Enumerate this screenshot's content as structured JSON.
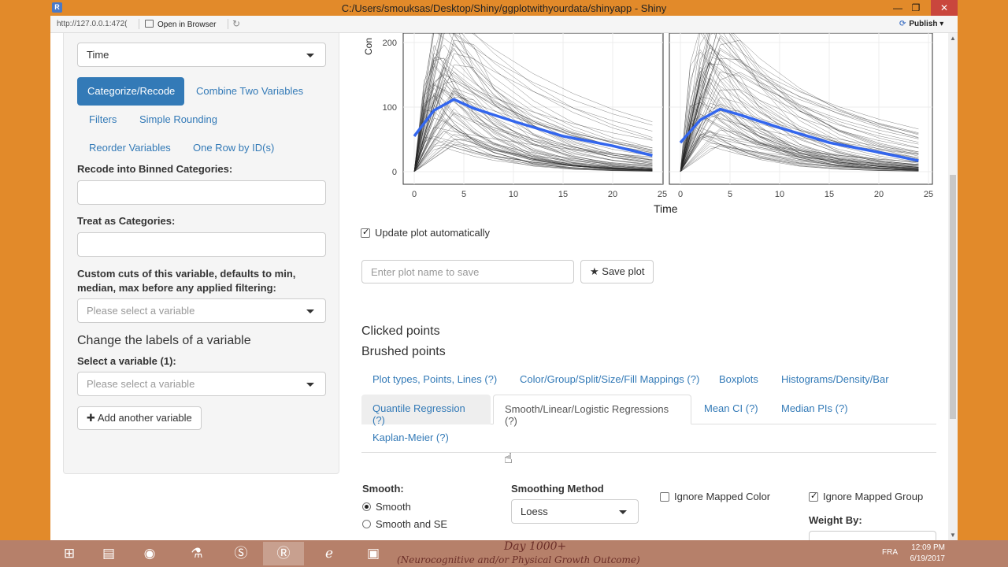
{
  "window": {
    "title": "C:/Users/smouksas/Desktop/Shiny/ggplotwithyourdata/shinyapp - Shiny",
    "minimize": "—",
    "maximize": "❐",
    "close": "✕"
  },
  "toolbar": {
    "url": "http://127.0.0.1:472(",
    "open_in_browser": "Open in Browser",
    "refresh": "↻",
    "publish": "Publish"
  },
  "sidebar": {
    "time_select": "Time",
    "tabs": [
      {
        "label": "Categorize/Recode",
        "active": true
      },
      {
        "label": "Combine Two Variables"
      },
      {
        "label": "Filters"
      },
      {
        "label": "Simple Rounding"
      },
      {
        "label": "Reorder Variables"
      },
      {
        "label": "One Row by ID(s)"
      }
    ],
    "recode_label": "Recode into Binned Categories:",
    "treat_label": "Treat as Categories:",
    "custom_cuts_label": "Custom cuts of this variable, defaults to min, median, max before any applied filtering:",
    "custom_cuts_placeholder": "Please select a variable",
    "change_labels_heading": "Change the labels of a variable",
    "select_variable_label": "Select a variable (1):",
    "select_variable_placeholder": "Please select a variable",
    "add_variable_button": "Add another variable"
  },
  "plot": {
    "ylabel_fragment": "Con",
    "xlabel": "Time",
    "y_ticks": [
      "200",
      "100",
      "0"
    ],
    "x_ticks_left": [
      "0",
      "5",
      "10",
      "15",
      "20",
      "25"
    ],
    "x_ticks_right": [
      "0",
      "5",
      "10",
      "15",
      "20",
      "25"
    ],
    "line_color": "#3366ee"
  },
  "main": {
    "update_plot_label": "Update plot automatically",
    "update_plot_checked": true,
    "plot_name_placeholder": "Enter plot name to save",
    "save_plot_button": "Save plot",
    "clicked_points": "Clicked points",
    "brushed_points": "Brushed points",
    "tabs_row1": [
      "Plot types, Points, Lines (?)",
      "Color/Group/Split/Size/Fill Mappings (?)",
      "Boxplots",
      "Histograms/Density/Bar"
    ],
    "tabs_row2": [
      "Quantile Regression (?)",
      "Smooth/Linear/Logistic Regressions (?)",
      "Mean CI (?)",
      "Median PIs (?)"
    ],
    "tabs_row3": [
      "Kaplan-Meier (?)"
    ],
    "smooth_label": "Smooth:",
    "smooth_options": [
      "Smooth",
      "Smooth and SE"
    ],
    "smoothing_method_label": "Smoothing Method",
    "smoothing_method_value": "Loess",
    "ignore_mapped_color": "Ignore Mapped Color",
    "ignore_mapped_group": "Ignore Mapped Group",
    "weight_by_label": "Weight By:"
  },
  "taskbar": {
    "items": [
      "windows-start",
      "file-explorer",
      "chrome",
      "r-studio",
      "skype",
      "r",
      "internet-explorer",
      "powerpoint"
    ],
    "wallpaper_line1": "(Neurocognitive and/or Physical Growth Outcome)",
    "wallpaper_line2": "Day 1000+",
    "language": "FRA",
    "time": "12:09 PM",
    "date": "6/19/2017"
  }
}
